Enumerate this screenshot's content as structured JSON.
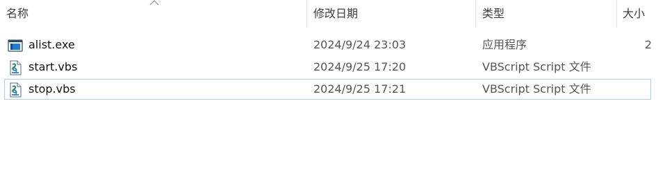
{
  "columns": {
    "name": "名称",
    "date": "修改日期",
    "type": "类型",
    "size": "大小"
  },
  "files": [
    {
      "name": "alist.exe",
      "date": "2024/9/24 23:03",
      "type": "应用程序",
      "size": "2",
      "icon": "application-window-icon"
    },
    {
      "name": "start.vbs",
      "date": "2024/9/25 17:20",
      "type": "VBScript Script 文件",
      "size": "",
      "icon": "vbscript-file-icon"
    },
    {
      "name": "stop.vbs",
      "date": "2024/9/25 17:21",
      "type": "VBScript Script 文件",
      "size": "",
      "icon": "vbscript-file-icon",
      "focused": true
    }
  ],
  "colors": {
    "focus_border": "#9fd0e8",
    "separator": "#e5e5e5",
    "app_icon_blue": "#1e7bd6"
  }
}
